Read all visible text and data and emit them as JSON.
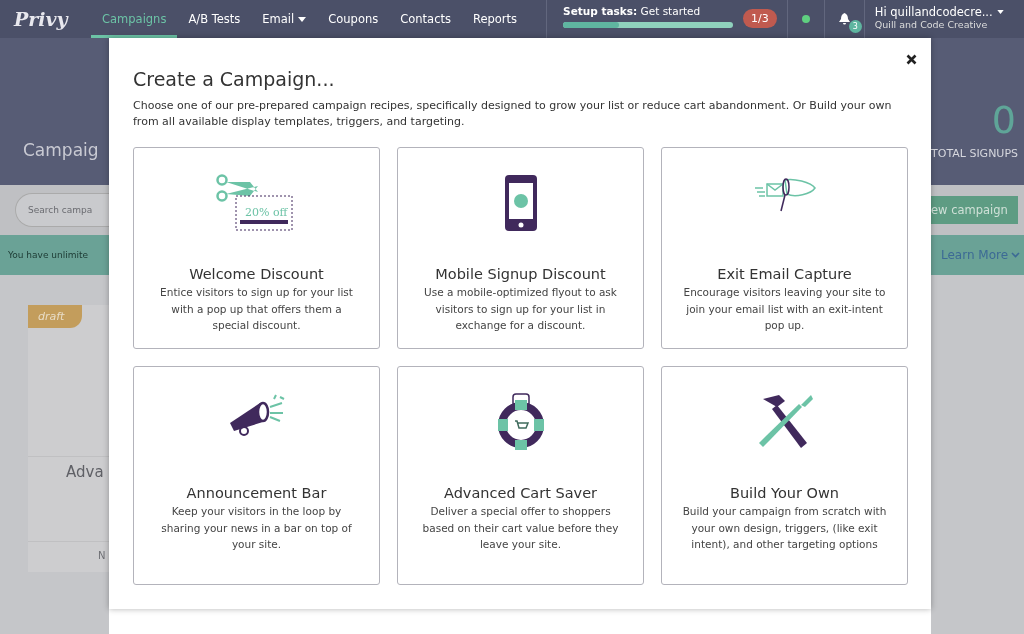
{
  "nav": {
    "logo": "Privy",
    "tabs": [
      {
        "label": "Campaigns",
        "selected": true,
        "dropdown": false
      },
      {
        "label": "A/B Tests",
        "selected": false,
        "dropdown": false
      },
      {
        "label": "Email",
        "selected": false,
        "dropdown": true
      },
      {
        "label": "Coupons",
        "selected": false,
        "dropdown": false
      },
      {
        "label": "Contacts",
        "selected": false,
        "dropdown": false
      },
      {
        "label": "Reports",
        "selected": false,
        "dropdown": false
      }
    ],
    "setup": {
      "label": "Setup tasks:",
      "link": "Get started",
      "level": 0.33,
      "count": "1/3"
    },
    "notifications": "3",
    "user": {
      "greeting": "Hi quillandcodecre...",
      "company": "Quill and Code Creative"
    }
  },
  "background": {
    "heading": "Campaig",
    "search_placeholder": "Search campa",
    "banner": "You have unlimite",
    "card": {
      "badge": "draft",
      "title": "Adva",
      "footer": "N"
    },
    "signups_count": "0",
    "signups_label": "TOTAL SIGNUPS",
    "new_button": "ew campaign",
    "learn_more": "Learn More"
  },
  "modal": {
    "title": "Create a Campaign...",
    "description": "Choose one of our pre-prepared campaign recipes, specifically designed to grow your list or reduce cart abandonment. Or Build your own from all available display templates, triggers, and targeting.",
    "recipes": [
      {
        "kind": "welcome",
        "coupon": "20% off",
        "title": "Welcome Discount",
        "text": "Entice visitors to sign up for your list with a pop up that offers them a special discount."
      },
      {
        "kind": "mobile",
        "title": "Mobile Signup Discount",
        "text": "Use a mobile-optimized flyout to ask visitors to sign up for your list in exchange for a discount."
      },
      {
        "kind": "exit",
        "title": "Exit Email Capture",
        "text": "Encourage visitors leaving your site to join your email list with an exit-intent pop up."
      },
      {
        "kind": "announcement",
        "title": "Announcement Bar",
        "text": "Keep your visitors in the loop by sharing your news in a bar on top of your site."
      },
      {
        "kind": "cart",
        "title": "Advanced Cart Saver",
        "text": "Deliver a special offer to shoppers based on their cart value before they leave your site."
      },
      {
        "kind": "build",
        "title": "Build Your Own",
        "text": "Build your campaign from scratch with your own design, triggers, (like exit intent), and other targeting options"
      }
    ]
  }
}
